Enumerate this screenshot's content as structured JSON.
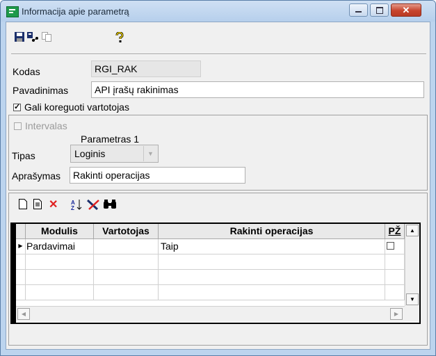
{
  "window": {
    "title": "Informacija apie parametrą"
  },
  "toolbar": {
    "save_icon": "save-icon",
    "users_icon": "users-icon",
    "copy_icon": "copy-icon",
    "help_icon": "help-icon"
  },
  "form": {
    "kodas_label": "Kodas",
    "kodas_value": "RGI_RAK",
    "pavadinimas_label": "Pavadinimas",
    "pavadinimas_value": "API įrašų rakinimas",
    "user_edit_label": "Gali koreguoti vartotojas",
    "user_edit_checked": true
  },
  "interval": {
    "label": "Intervalas",
    "checked": false,
    "param_header": "Parametras 1",
    "tipas_label": "Tipas",
    "tipas_value": "Loginis",
    "aprasymas_label": "Aprašymas",
    "aprasymas_value": "Rakinti operacijas"
  },
  "grid": {
    "columns": [
      "Modulis",
      "Vartotojas",
      "Rakinti operacijas",
      "PŽ"
    ],
    "rows": [
      {
        "modulis": "Pardavimai",
        "vartotojas": "",
        "rakinti": "Taip",
        "pz": false
      }
    ]
  },
  "colors": {
    "title_bg": "#bcd4ee",
    "close_button": "#c7442d",
    "app_icon": "#1e9a4a"
  }
}
